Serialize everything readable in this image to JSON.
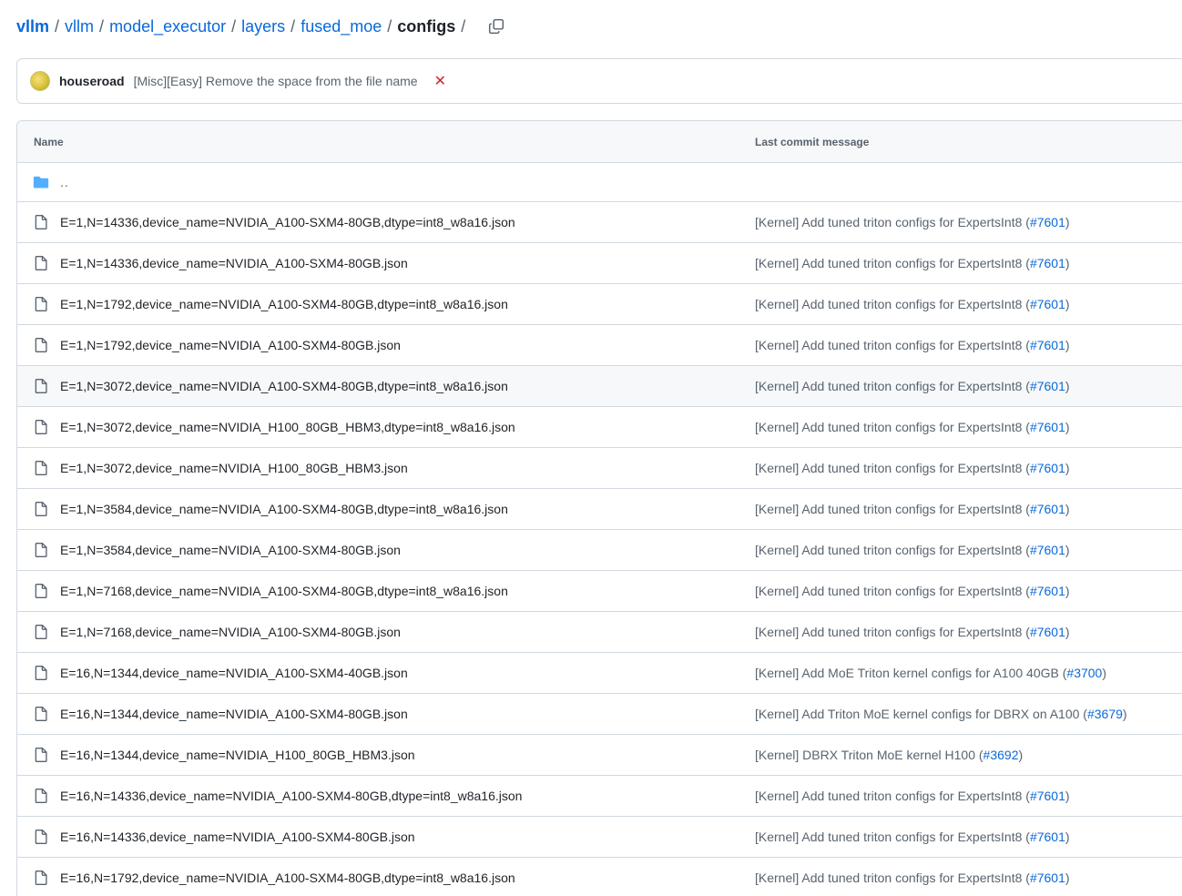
{
  "breadcrumb": {
    "items": [
      "vllm",
      "vllm",
      "model_executor",
      "layers",
      "fused_moe"
    ],
    "current": "configs",
    "separator": "/"
  },
  "commit": {
    "author": "houseroad",
    "message": "[Misc][Easy] Remove the space from the file name",
    "status": "✕"
  },
  "table": {
    "columns": {
      "name": "Name",
      "last_commit_message": "Last commit message"
    },
    "parent_label": "..",
    "rows": [
      {
        "name": "E=1,N=14336,device_name=NVIDIA_A100-SXM4-80GB,dtype=int8_w8a16.json",
        "msg": "[Kernel] Add tuned triton configs for ExpertsInt8 (",
        "pr": "#7601",
        "close": ")"
      },
      {
        "name": "E=1,N=14336,device_name=NVIDIA_A100-SXM4-80GB.json",
        "msg": "[Kernel] Add tuned triton configs for ExpertsInt8 (",
        "pr": "#7601",
        "close": ")"
      },
      {
        "name": "E=1,N=1792,device_name=NVIDIA_A100-SXM4-80GB,dtype=int8_w8a16.json",
        "msg": "[Kernel] Add tuned triton configs for ExpertsInt8 (",
        "pr": "#7601",
        "close": ")"
      },
      {
        "name": "E=1,N=1792,device_name=NVIDIA_A100-SXM4-80GB.json",
        "msg": "[Kernel] Add tuned triton configs for ExpertsInt8 (",
        "pr": "#7601",
        "close": ")"
      },
      {
        "name": "E=1,N=3072,device_name=NVIDIA_A100-SXM4-80GB,dtype=int8_w8a16.json",
        "msg": "[Kernel] Add tuned triton configs for ExpertsInt8 (",
        "pr": "#7601",
        "close": ")"
      },
      {
        "name": "E=1,N=3072,device_name=NVIDIA_H100_80GB_HBM3,dtype=int8_w8a16.json",
        "msg": "[Kernel] Add tuned triton configs for ExpertsInt8 (",
        "pr": "#7601",
        "close": ")"
      },
      {
        "name": "E=1,N=3072,device_name=NVIDIA_H100_80GB_HBM3.json",
        "msg": "[Kernel] Add tuned triton configs for ExpertsInt8 (",
        "pr": "#7601",
        "close": ")"
      },
      {
        "name": "E=1,N=3584,device_name=NVIDIA_A100-SXM4-80GB,dtype=int8_w8a16.json",
        "msg": "[Kernel] Add tuned triton configs for ExpertsInt8 (",
        "pr": "#7601",
        "close": ")"
      },
      {
        "name": "E=1,N=3584,device_name=NVIDIA_A100-SXM4-80GB.json",
        "msg": "[Kernel] Add tuned triton configs for ExpertsInt8 (",
        "pr": "#7601",
        "close": ")"
      },
      {
        "name": "E=1,N=7168,device_name=NVIDIA_A100-SXM4-80GB,dtype=int8_w8a16.json",
        "msg": "[Kernel] Add tuned triton configs for ExpertsInt8 (",
        "pr": "#7601",
        "close": ")"
      },
      {
        "name": "E=1,N=7168,device_name=NVIDIA_A100-SXM4-80GB.json",
        "msg": "[Kernel] Add tuned triton configs for ExpertsInt8 (",
        "pr": "#7601",
        "close": ")"
      },
      {
        "name": "E=16,N=1344,device_name=NVIDIA_A100-SXM4-40GB.json",
        "msg": "[Kernel] Add MoE Triton kernel configs for A100 40GB (",
        "pr": "#3700",
        "close": ")"
      },
      {
        "name": "E=16,N=1344,device_name=NVIDIA_A100-SXM4-80GB.json",
        "msg": "[Kernel] Add Triton MoE kernel configs for DBRX on A100 (",
        "pr": "#3679",
        "close": ")"
      },
      {
        "name": "E=16,N=1344,device_name=NVIDIA_H100_80GB_HBM3.json",
        "msg": "[Kernel] DBRX Triton MoE kernel H100 (",
        "pr": "#3692",
        "close": ")"
      },
      {
        "name": "E=16,N=14336,device_name=NVIDIA_A100-SXM4-80GB,dtype=int8_w8a16.json",
        "msg": "[Kernel] Add tuned triton configs for ExpertsInt8 (",
        "pr": "#7601",
        "close": ")"
      },
      {
        "name": "E=16,N=14336,device_name=NVIDIA_A100-SXM4-80GB.json",
        "msg": "[Kernel] Add tuned triton configs for ExpertsInt8 (",
        "pr": "#7601",
        "close": ")"
      },
      {
        "name": "E=16,N=1792,device_name=NVIDIA_A100-SXM4-80GB,dtype=int8_w8a16.json",
        "msg": "[Kernel] Add tuned triton configs for ExpertsInt8 (",
        "pr": "#7601",
        "close": ")"
      }
    ]
  },
  "icons": {
    "folder": "folder-icon",
    "file": "file-icon",
    "copy": "copy-icon",
    "status": "x-icon"
  },
  "colors": {
    "link": "#0969da",
    "text": "#1f2328",
    "muted": "#59636e",
    "border": "#d1d9e0",
    "header_bg": "#f6f8fa",
    "folder": "#54aeff",
    "error": "#d1242f"
  }
}
